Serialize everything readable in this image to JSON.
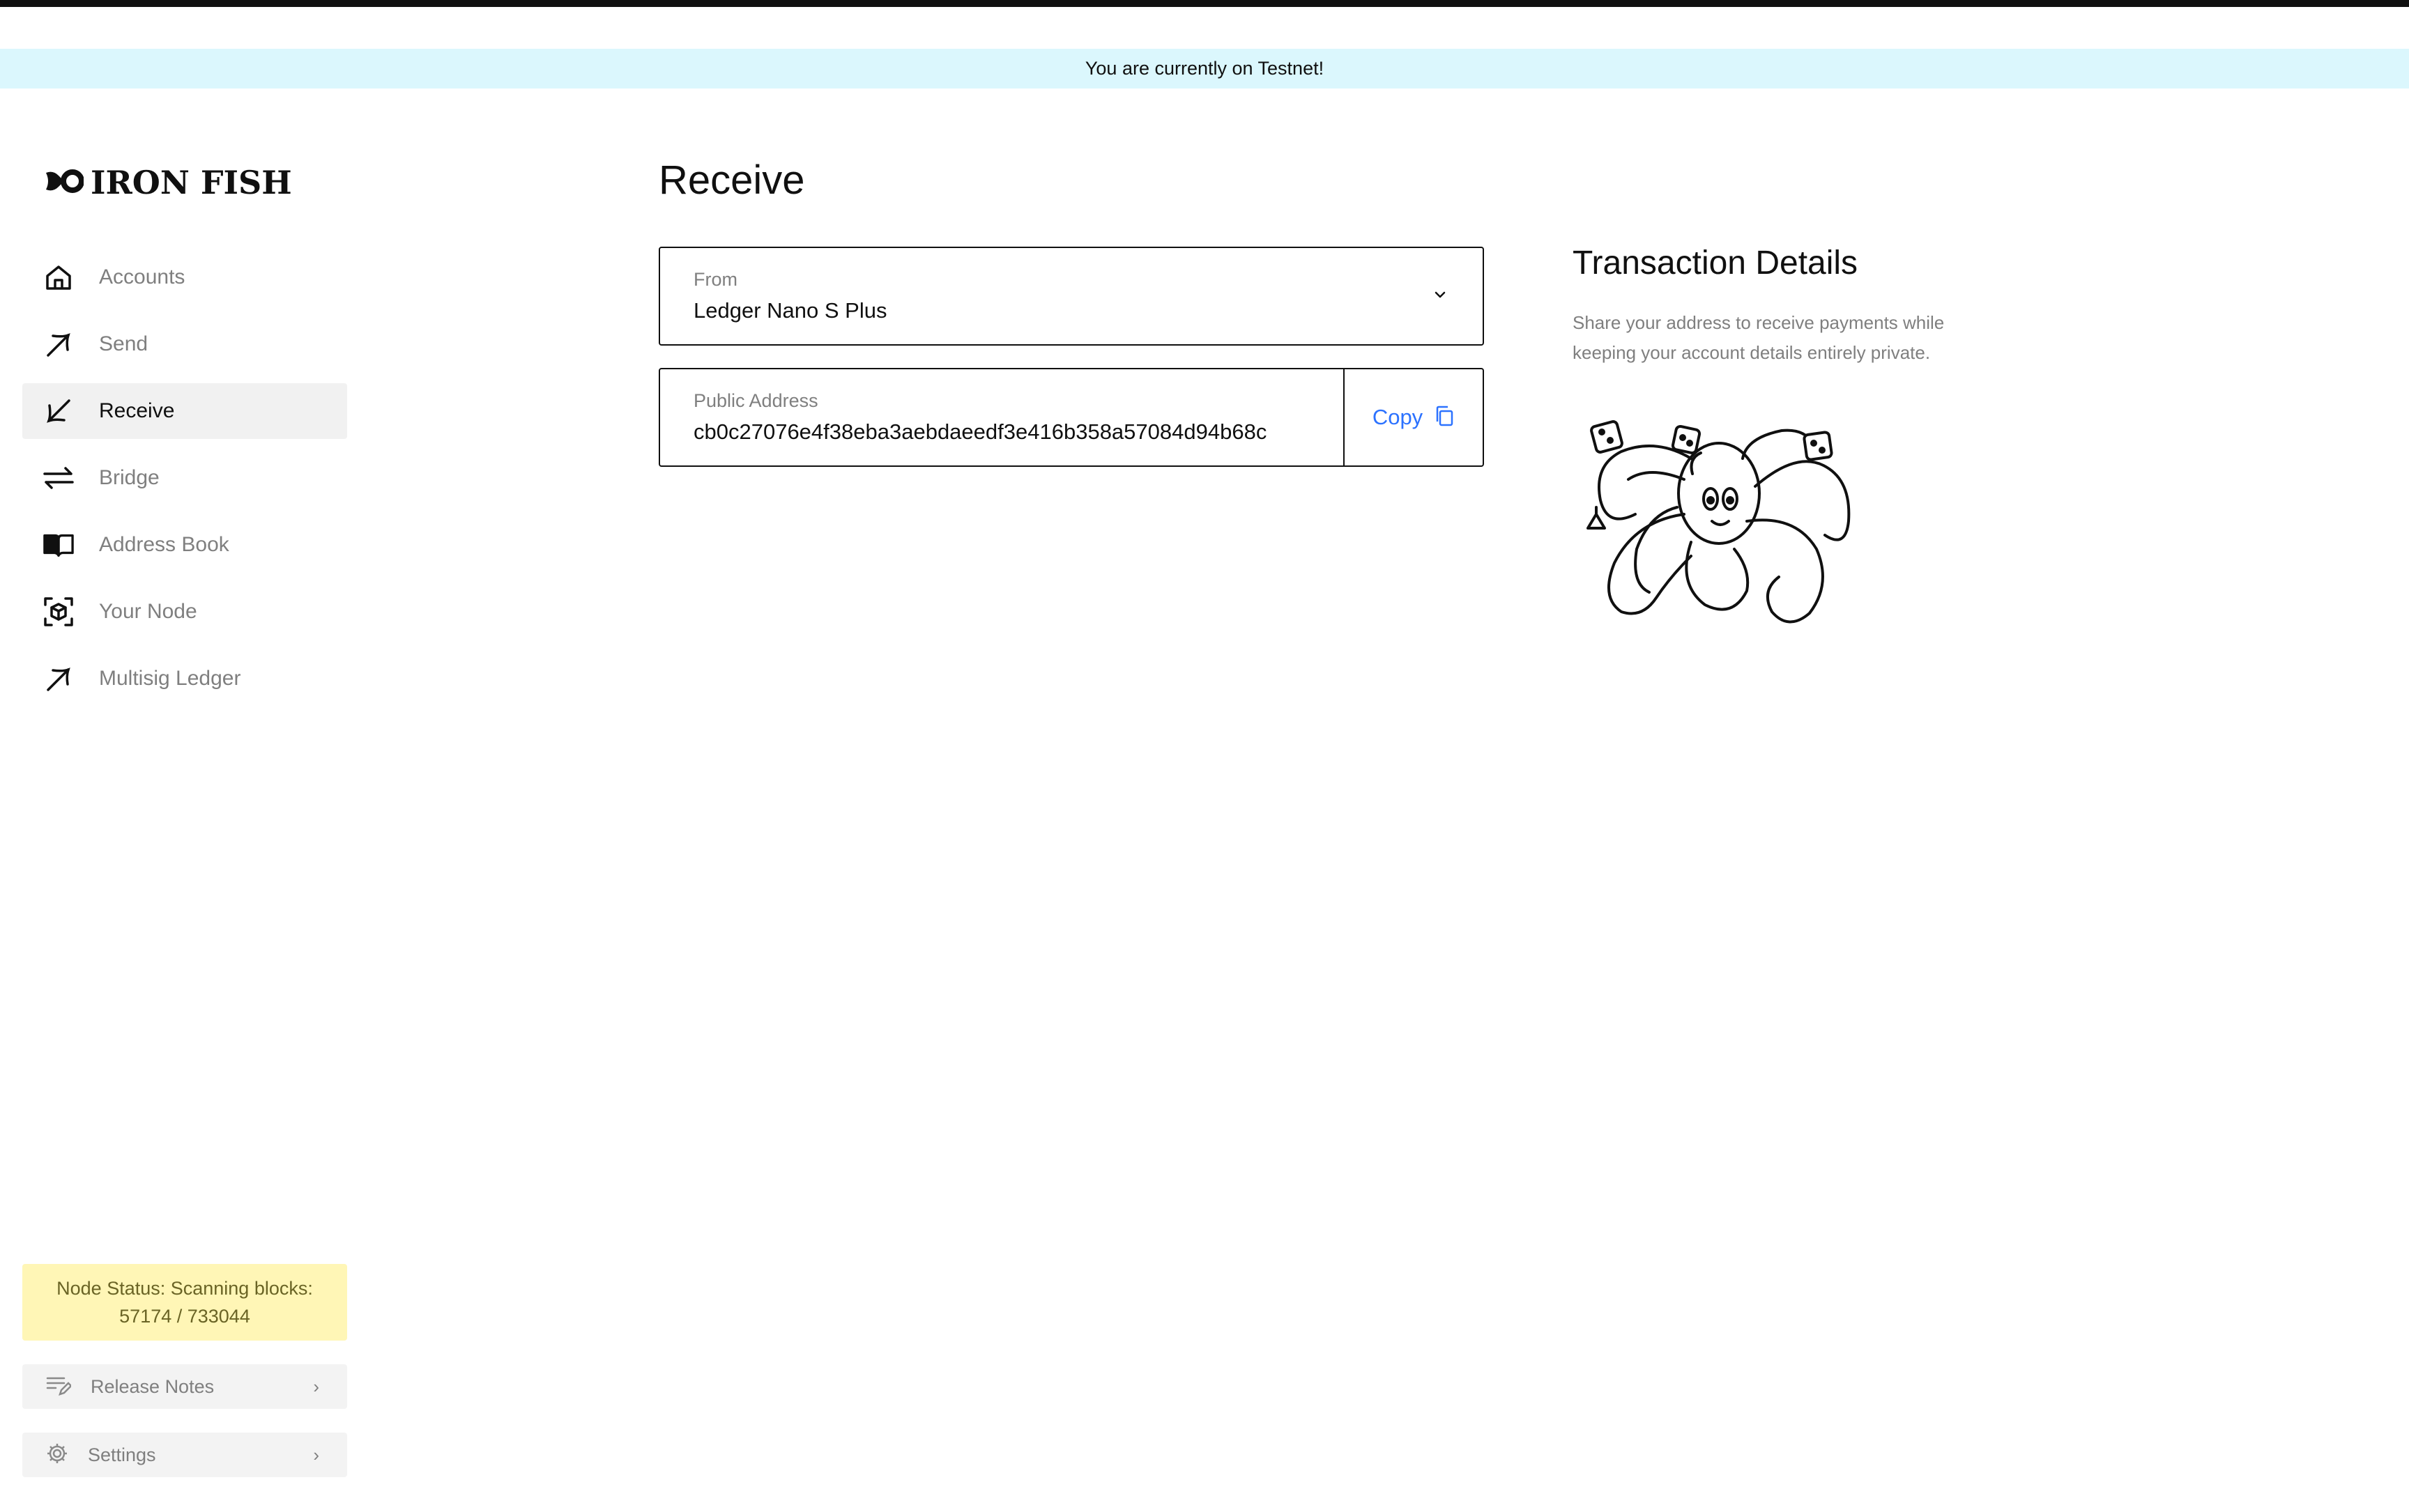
{
  "banner": {
    "text": "You are currently on Testnet!"
  },
  "app": {
    "logo_text": "IRON FISH"
  },
  "sidebar": {
    "items": [
      {
        "label": "Accounts",
        "icon": "home-icon",
        "active": false
      },
      {
        "label": "Send",
        "icon": "arrow-up-right-icon",
        "active": false
      },
      {
        "label": "Receive",
        "icon": "arrow-down-left-icon",
        "active": true
      },
      {
        "label": "Bridge",
        "icon": "bridge-arrows-icon",
        "active": false
      },
      {
        "label": "Address Book",
        "icon": "book-icon",
        "active": false
      },
      {
        "label": "Your Node",
        "icon": "node-cube-icon",
        "active": false
      },
      {
        "label": "Multisig Ledger",
        "icon": "arrow-up-right-icon",
        "active": false
      }
    ],
    "node_status_line1": "Node Status: Scanning blocks:",
    "node_status_line2": "57174 / 733044",
    "release_notes_label": "Release Notes",
    "settings_label": "Settings"
  },
  "main": {
    "title": "Receive",
    "from": {
      "label": "From",
      "value": "Ledger Nano S Plus"
    },
    "address": {
      "label": "Public Address",
      "value": "cb0c27076e4f38eba3aebdaeedf3e416b358a57084d94b68c",
      "copy_label": "Copy"
    }
  },
  "details": {
    "title": "Transaction Details",
    "description": "Share your address to receive payments while keeping your account details entirely private."
  },
  "colors": {
    "banner_bg": "#dbf7fd",
    "accent": "#2c72ff",
    "node_status_bg": "#fff6b6",
    "active_nav_bg": "#f1f1f1"
  }
}
